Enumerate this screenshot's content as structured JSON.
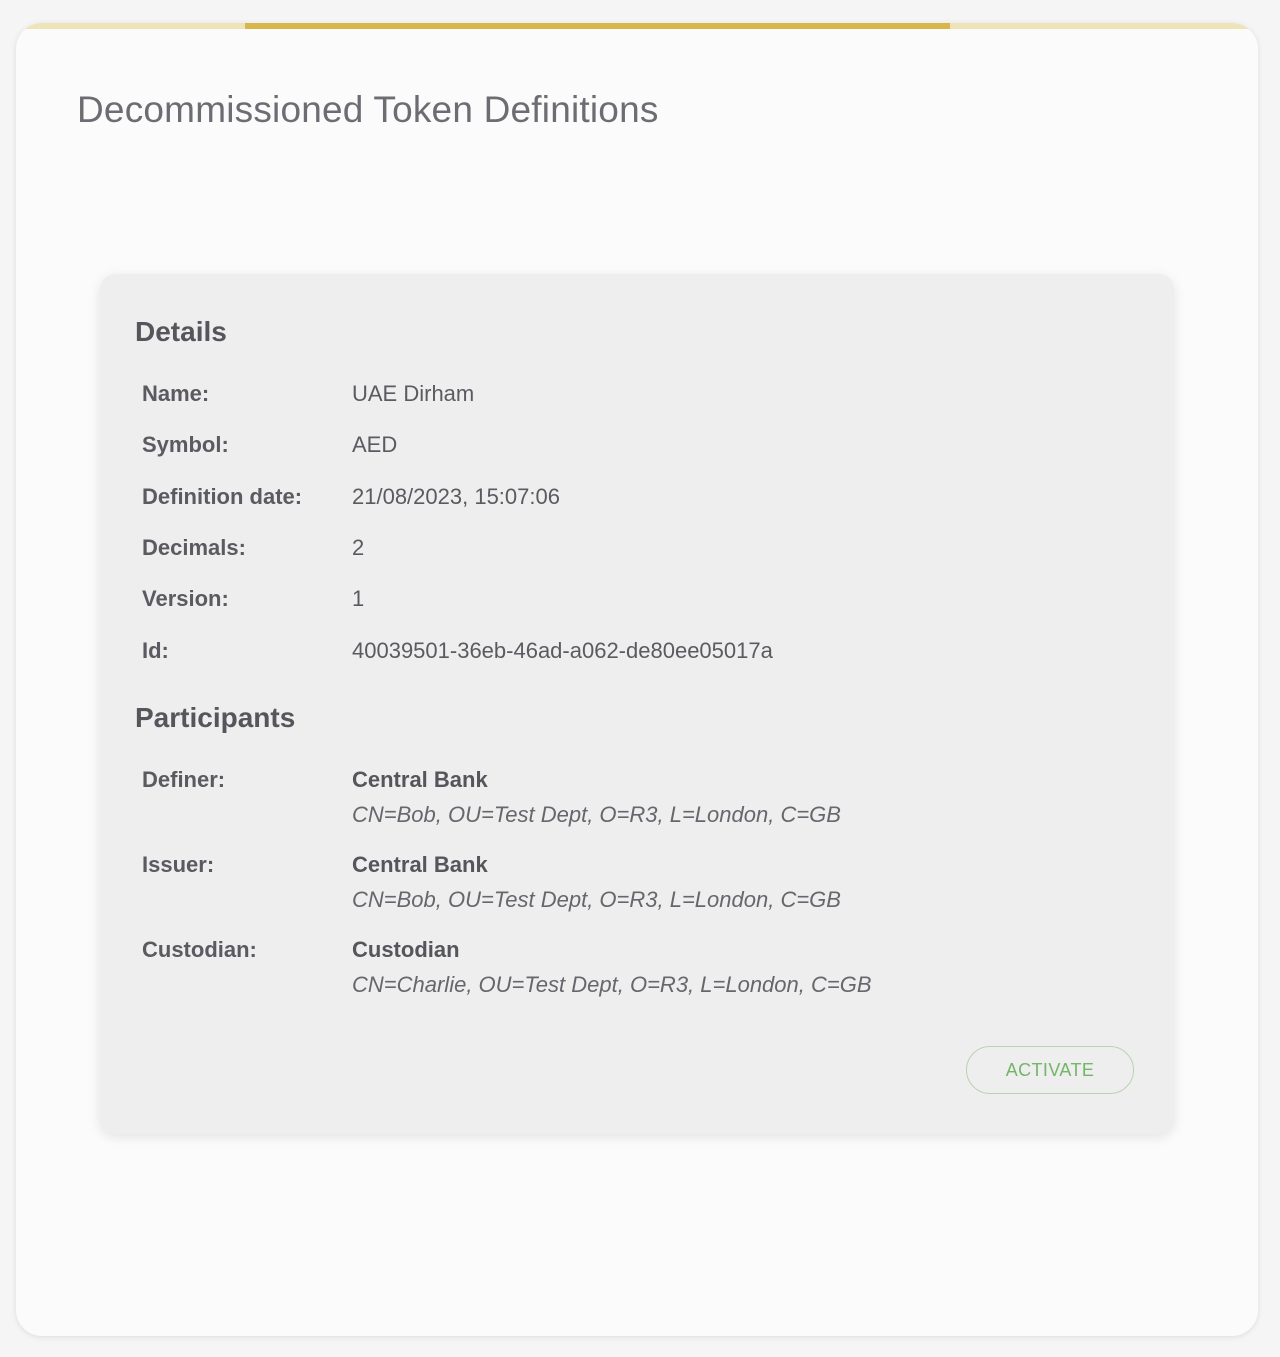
{
  "page": {
    "title": "Decommissioned Token Definitions",
    "progress_fraction": 0.57
  },
  "details": {
    "heading": "Details",
    "fields": [
      {
        "label": "Name:",
        "value": "UAE Dirham"
      },
      {
        "label": "Symbol:",
        "value": "AED"
      },
      {
        "label": "Definition date:",
        "value": "21/08/2023, 15:07:06"
      },
      {
        "label": "Decimals:",
        "value": "2"
      },
      {
        "label": "Version:",
        "value": "1"
      },
      {
        "label": "Id:",
        "value": "40039501-36eb-46ad-a062-de80ee05017a"
      }
    ]
  },
  "participants": {
    "heading": "Participants",
    "items": [
      {
        "role": "Definer:",
        "name": "Central Bank",
        "dn": "CN=Bob, OU=Test Dept, O=R3, L=London, C=GB"
      },
      {
        "role": "Issuer:",
        "name": "Central Bank",
        "dn": "CN=Bob, OU=Test Dept, O=R3, L=London, C=GB"
      },
      {
        "role": "Custodian:",
        "name": "Custodian",
        "dn": "CN=Charlie, OU=Test Dept, O=R3, L=London, C=GB"
      }
    ]
  },
  "actions": {
    "activate_label": "ACTIVATE"
  },
  "colors": {
    "accent": "#d8b64a",
    "accent_light": "#efe4b8",
    "activate_text": "#74b56a",
    "activate_border": "#b9d3b3"
  }
}
